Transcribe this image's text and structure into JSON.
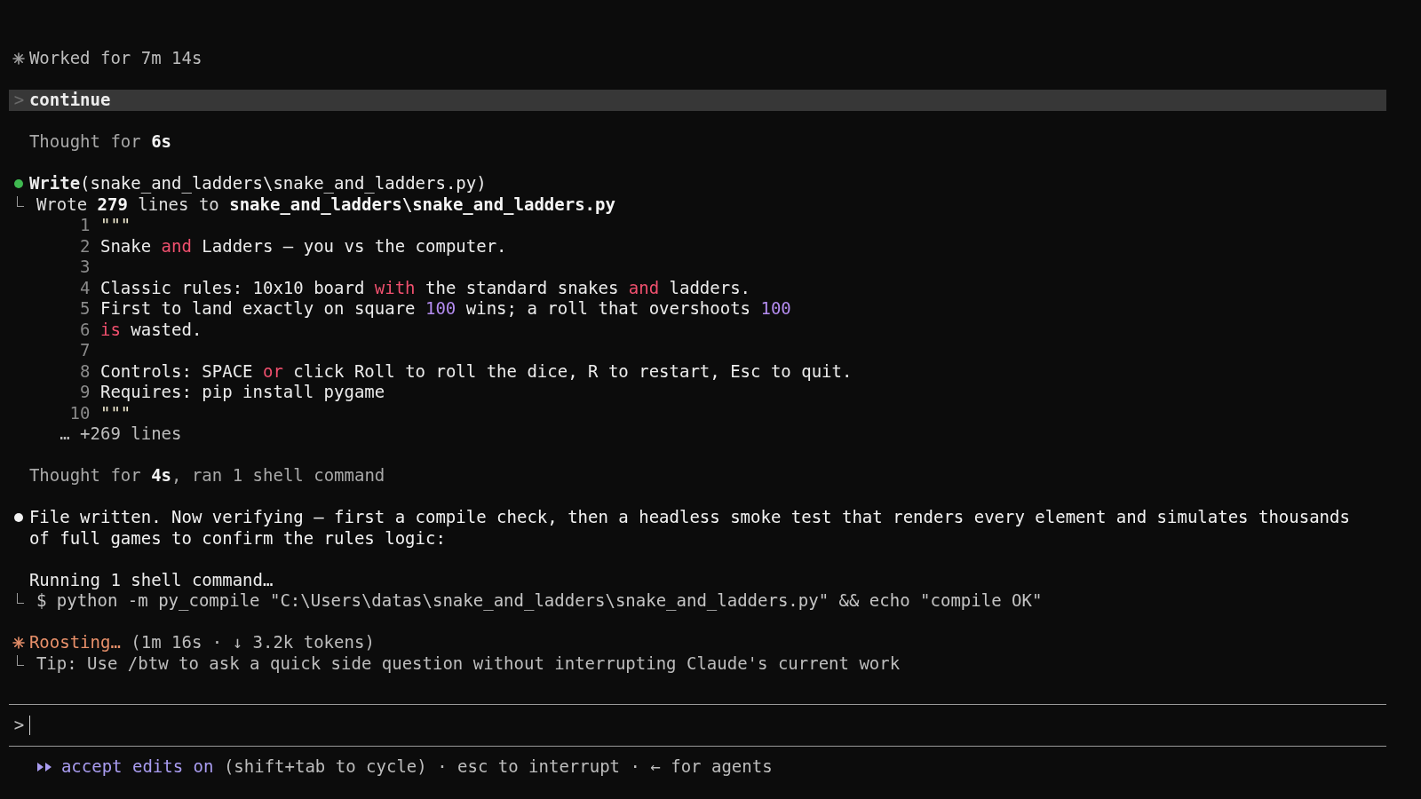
{
  "transcript": [
    {
      "kind": "status",
      "text": "Worked for 7m 14s"
    },
    {
      "kind": "user",
      "prompt": ">",
      "text": "continue"
    },
    {
      "kind": "thought",
      "text": "Thought for **6s**"
    },
    {
      "kind": "tool",
      "color": "#3fb950",
      "name": "Write",
      "args": "(snake_and_ladders\\snake_and_ladders.py)",
      "result": "Wrote **279** lines to **snake_and_ladders\\snake_and_ladders.py**",
      "code": [
        {
          "n": "1",
          "segments": [
            {
              "kind": "string",
              "text": "\"\"\""
            }
          ]
        },
        {
          "n": "2",
          "segments": [
            {
              "kind": "plain",
              "text": "Snake "
            },
            {
              "kind": "keyword",
              "text": "and"
            },
            {
              "kind": "plain",
              "text": " Ladders – you vs the computer."
            }
          ]
        },
        {
          "n": "3"
        },
        {
          "n": "4",
          "segments": [
            {
              "kind": "plain",
              "text": "Classic rules: 10x10 board "
            },
            {
              "kind": "keyword",
              "text": "with"
            },
            {
              "kind": "plain",
              "text": " the standard snakes "
            },
            {
              "kind": "keyword",
              "text": "and"
            },
            {
              "kind": "plain",
              "text": " ladders."
            }
          ]
        },
        {
          "n": "5",
          "segments": [
            {
              "kind": "plain",
              "text": "First to land exactly on square "
            },
            {
              "kind": "number",
              "text": "100"
            },
            {
              "kind": "plain",
              "text": " wins; a roll that overshoots "
            },
            {
              "kind": "number",
              "text": "100"
            }
          ]
        },
        {
          "n": "6",
          "segments": [
            {
              "kind": "keyword",
              "text": "is"
            },
            {
              "kind": "plain",
              "text": " wasted."
            }
          ]
        },
        {
          "n": "7"
        },
        {
          "n": "8",
          "segments": [
            {
              "kind": "plain",
              "text": "Controls: SPACE "
            },
            {
              "kind": "keyword",
              "text": "or"
            },
            {
              "kind": "plain",
              "text": " click Roll to roll the dice, R to restart, Esc to quit."
            }
          ]
        },
        {
          "n": "9",
          "segments": [
            {
              "kind": "plain",
              "text": "Requires: pip install pygame"
            }
          ]
        },
        {
          "n": "10",
          "segments": [
            {
              "kind": "string",
              "text": "\"\"\""
            }
          ]
        }
      ],
      "more": "… +269 lines"
    },
    {
      "kind": "thought",
      "text": "Thought for **4s**, ran 1 shell command"
    },
    {
      "kind": "message",
      "color": "#f2f2f2",
      "text": "File written. Now verifying – first a compile check, then a headless smoke test that renders every element and simulates thousands of full games to confirm the rules logic:"
    },
    {
      "kind": "running",
      "text": "Running 1 shell command…",
      "command": "$ python -m py_compile \"C:\\Users\\datas\\snake_and_ladders\\snake_and_ladders.py\" && echo \"compile OK\""
    }
  ],
  "spinner": {
    "verb": "Roosting…",
    "meta": "(1m 16s · ↓ 3.2k tokens)",
    "tip": "Tip: Use /btw to ask a quick side question without interrupting Claude's current work"
  },
  "input": {
    "prompt": ">"
  },
  "footer": {
    "mode": "accept edits on",
    "hint": "(shift+tab to cycle) · esc to interrupt · ← for agents"
  }
}
